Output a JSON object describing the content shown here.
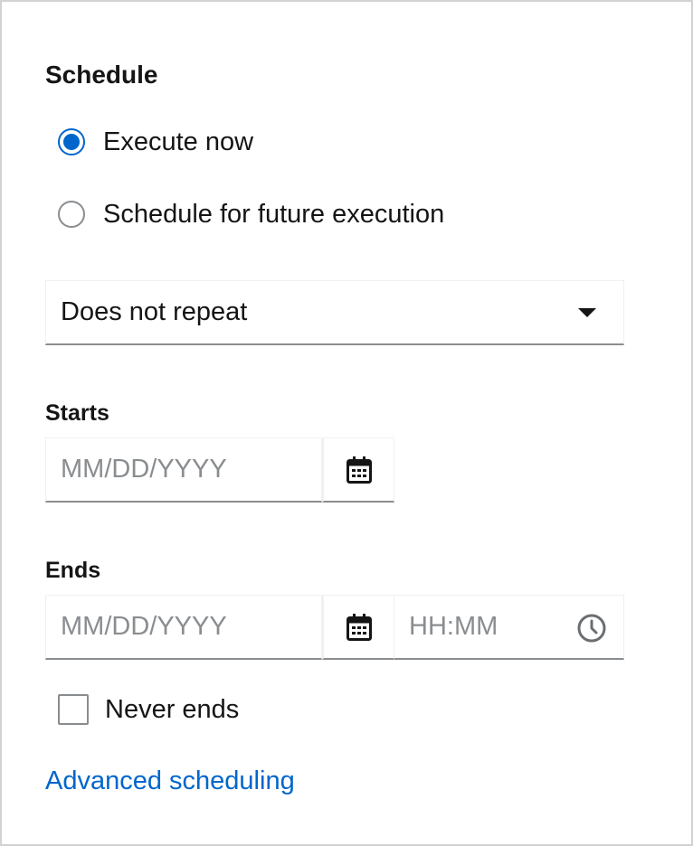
{
  "schedule": {
    "title": "Schedule",
    "options": [
      {
        "label": "Execute now",
        "checked": true
      },
      {
        "label": "Schedule for future execution",
        "checked": false
      }
    ]
  },
  "repeat": {
    "selected": "Does not repeat",
    "icon": "caret-down-icon"
  },
  "starts": {
    "label": "Starts",
    "date_placeholder": "MM/DD/YYYY",
    "date_value": "",
    "calendar_icon": "calendar-icon"
  },
  "ends": {
    "label": "Ends",
    "date_placeholder": "MM/DD/YYYY",
    "date_value": "",
    "time_placeholder": "HH:MM",
    "time_value": "",
    "calendar_icon": "calendar-icon",
    "clock_icon": "clock-icon"
  },
  "never_ends": {
    "label": "Never ends",
    "checked": false
  },
  "advanced_link": "Advanced scheduling",
  "colors": {
    "accent": "#0066cc",
    "border": "#8a8d90",
    "placeholder": "#8a8d90",
    "text": "#151515"
  }
}
